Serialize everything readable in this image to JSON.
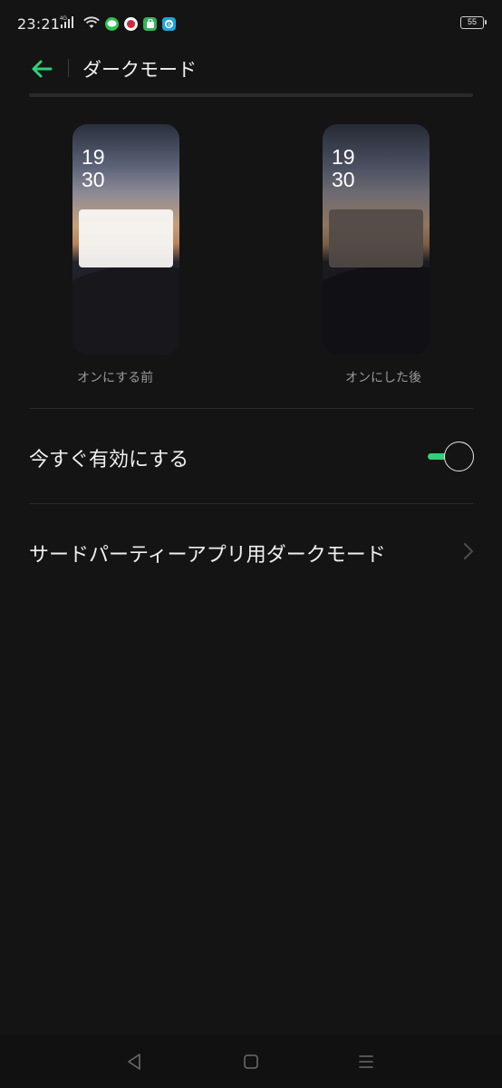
{
  "status_bar": {
    "time": "23:21",
    "network_type": "4G",
    "battery": "55",
    "notification_icons": [
      "line-icon",
      "dot-app-icon",
      "shopping-bag-icon",
      "e-app-icon"
    ]
  },
  "toolbar": {
    "title": "ダークモード",
    "back_icon": "arrow-left-icon",
    "accent_color": "#2fd07a"
  },
  "previews": {
    "before": {
      "caption": "オンにする前",
      "clock_hour": "19",
      "clock_minute": "30"
    },
    "after": {
      "caption": "オンにした後",
      "clock_hour": "19",
      "clock_minute": "30"
    }
  },
  "settings": {
    "enable_now": {
      "label": "今すぐ有効にする",
      "enabled": true
    },
    "third_party": {
      "label": "サードパーティーアプリ用ダークモード"
    }
  },
  "nav_bar": {
    "icons": [
      "back-triangle-icon",
      "home-square-icon",
      "menu-lines-icon"
    ]
  }
}
